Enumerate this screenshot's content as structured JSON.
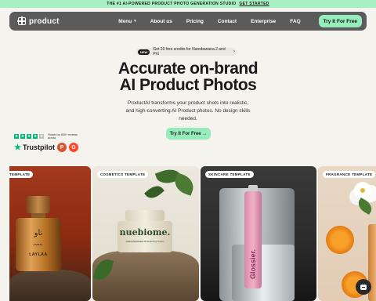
{
  "announcement": {
    "text": "THE #1 AI-POWERED PRODUCT PHOTO GENERATION STUDIO",
    "link": "GET STARTED"
  },
  "nav": {
    "logo": "product",
    "items": [
      {
        "label": "Menu",
        "has_dropdown": true
      },
      {
        "label": "About us"
      },
      {
        "label": "Pricing"
      },
      {
        "label": "Contact"
      },
      {
        "label": "Enterprise"
      },
      {
        "label": "FAQ"
      }
    ],
    "cta": "Try It For Free"
  },
  "badge": {
    "pill": "NEW",
    "text": "Get 20 free credits for Nanobanana 2 and Pro",
    "arrow": "›"
  },
  "hero": {
    "headline_line1": "Accurate on-brand",
    "headline_line2": "AI Product Photos",
    "subtitle": "ProductAI transforms your product shots into realistic, and high-converting AI Product photos. No design skills needed.",
    "cta": "Try It For Free →"
  },
  "rating": {
    "stars": 5,
    "note": "*Based on 836+ reviews across",
    "trustpilot": "Trustpilot",
    "producthunt_letter": "P",
    "g2_letter": "G"
  },
  "cards": [
    {
      "tag": "TEMPLATE",
      "bottle_script": "ناو",
      "bottle_label": "LAYLAA",
      "bottle_small": "JAMAL"
    },
    {
      "tag": "COSMETICS TEMPLATE",
      "brand": "nuebiome.",
      "small": "CERA BARRIER Moisturizing Cream"
    },
    {
      "tag": "SKINCARE TEMPLATE",
      "product": "Glossier."
    },
    {
      "tag": "FRAGRANCE TEMPLATE"
    }
  ],
  "colors": {
    "accent": "#96ecbb",
    "nav_bg": "#5b5b5b",
    "page_bg": "#f4f3ee"
  }
}
